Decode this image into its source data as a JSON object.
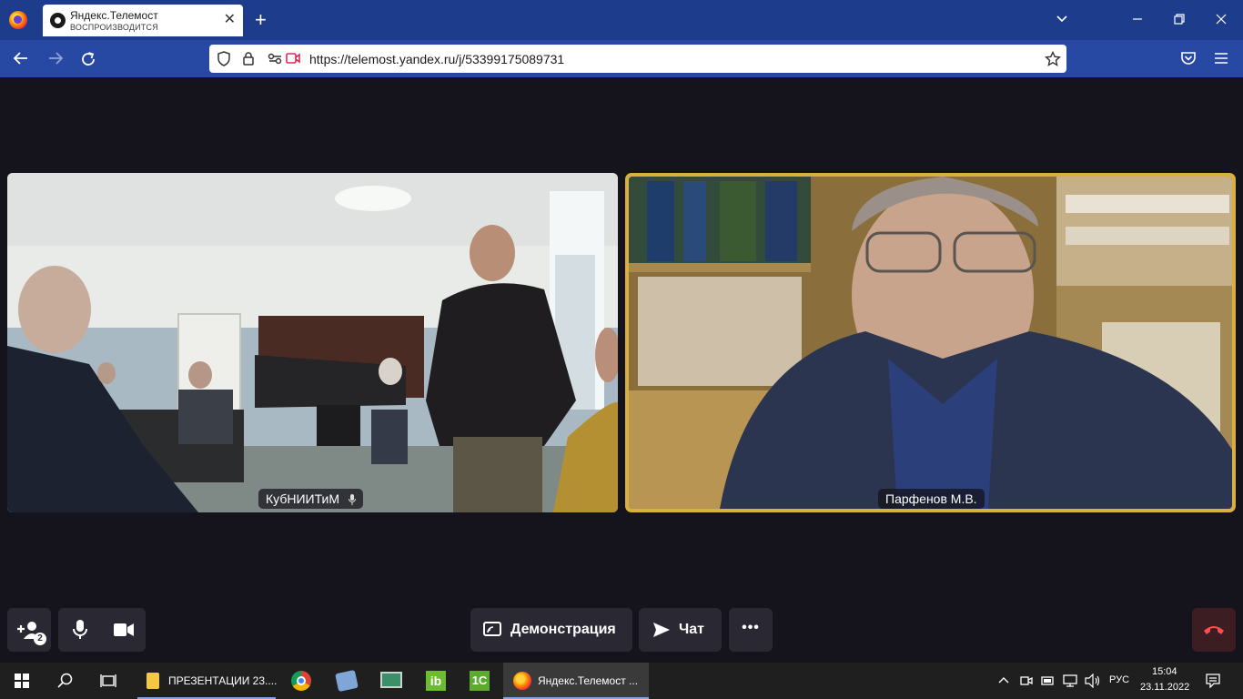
{
  "browser": {
    "tab": {
      "title": "Яндекс.Телемост",
      "subtitle": "ВОСПРОИЗВОДИТСЯ",
      "close": "✕"
    },
    "new_tab": "+",
    "url": "https://telemost.yandex.ru/j/53399175089731"
  },
  "participants": [
    {
      "name": "КубНИИТиМ",
      "muted": false
    },
    {
      "name": "Парфенов М.В.",
      "active_speaker": true
    }
  ],
  "controls": {
    "invite_badge": "2",
    "demonstration_label": "Демонстрация",
    "chat_label": "Чат",
    "more_label": "•••"
  },
  "taskbar": {
    "items": [
      {
        "label": "ПРЕЗЕНТАЦИИ 23...."
      },
      {
        "label": "Яндекс.Телемост ..."
      }
    ],
    "language": "РУС",
    "time": "15:04",
    "date": "23.11.2022"
  },
  "colors": {
    "tabbar": "#1e3c8c",
    "navbar": "#2849a3",
    "background": "#15131b",
    "speaker_border": "#d9b040",
    "control_bg": "#2a2833",
    "hangup_bg": "#3c1d22"
  }
}
